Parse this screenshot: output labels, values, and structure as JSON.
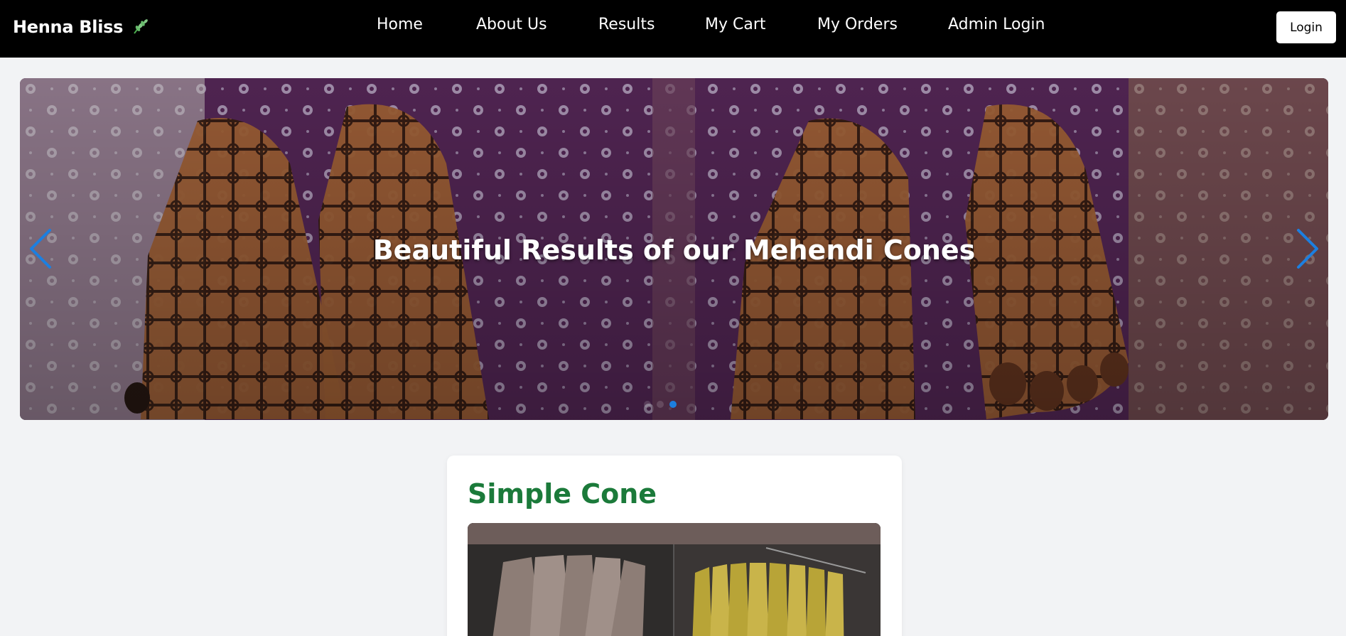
{
  "brand": {
    "name": "Henna Bliss",
    "icon": "leaf-icon"
  },
  "nav": {
    "items": [
      {
        "label": "Home"
      },
      {
        "label": "About Us"
      },
      {
        "label": "Results"
      },
      {
        "label": "My Cart"
      },
      {
        "label": "My Orders"
      },
      {
        "label": "Admin Login"
      }
    ],
    "login_label": "Login"
  },
  "carousel": {
    "caption": "Beautiful Results of our Mehendi Cones",
    "slide_count": 3,
    "active_index": 2,
    "prev_icon": "chevron-left-icon",
    "next_icon": "chevron-right-icon"
  },
  "product": {
    "title": "Simple Cone"
  },
  "colors": {
    "navbar_bg": "#000000",
    "page_bg": "#f2f3f5",
    "accent_green": "#1b7a3a",
    "indicator_active": "#1c7fe0"
  }
}
